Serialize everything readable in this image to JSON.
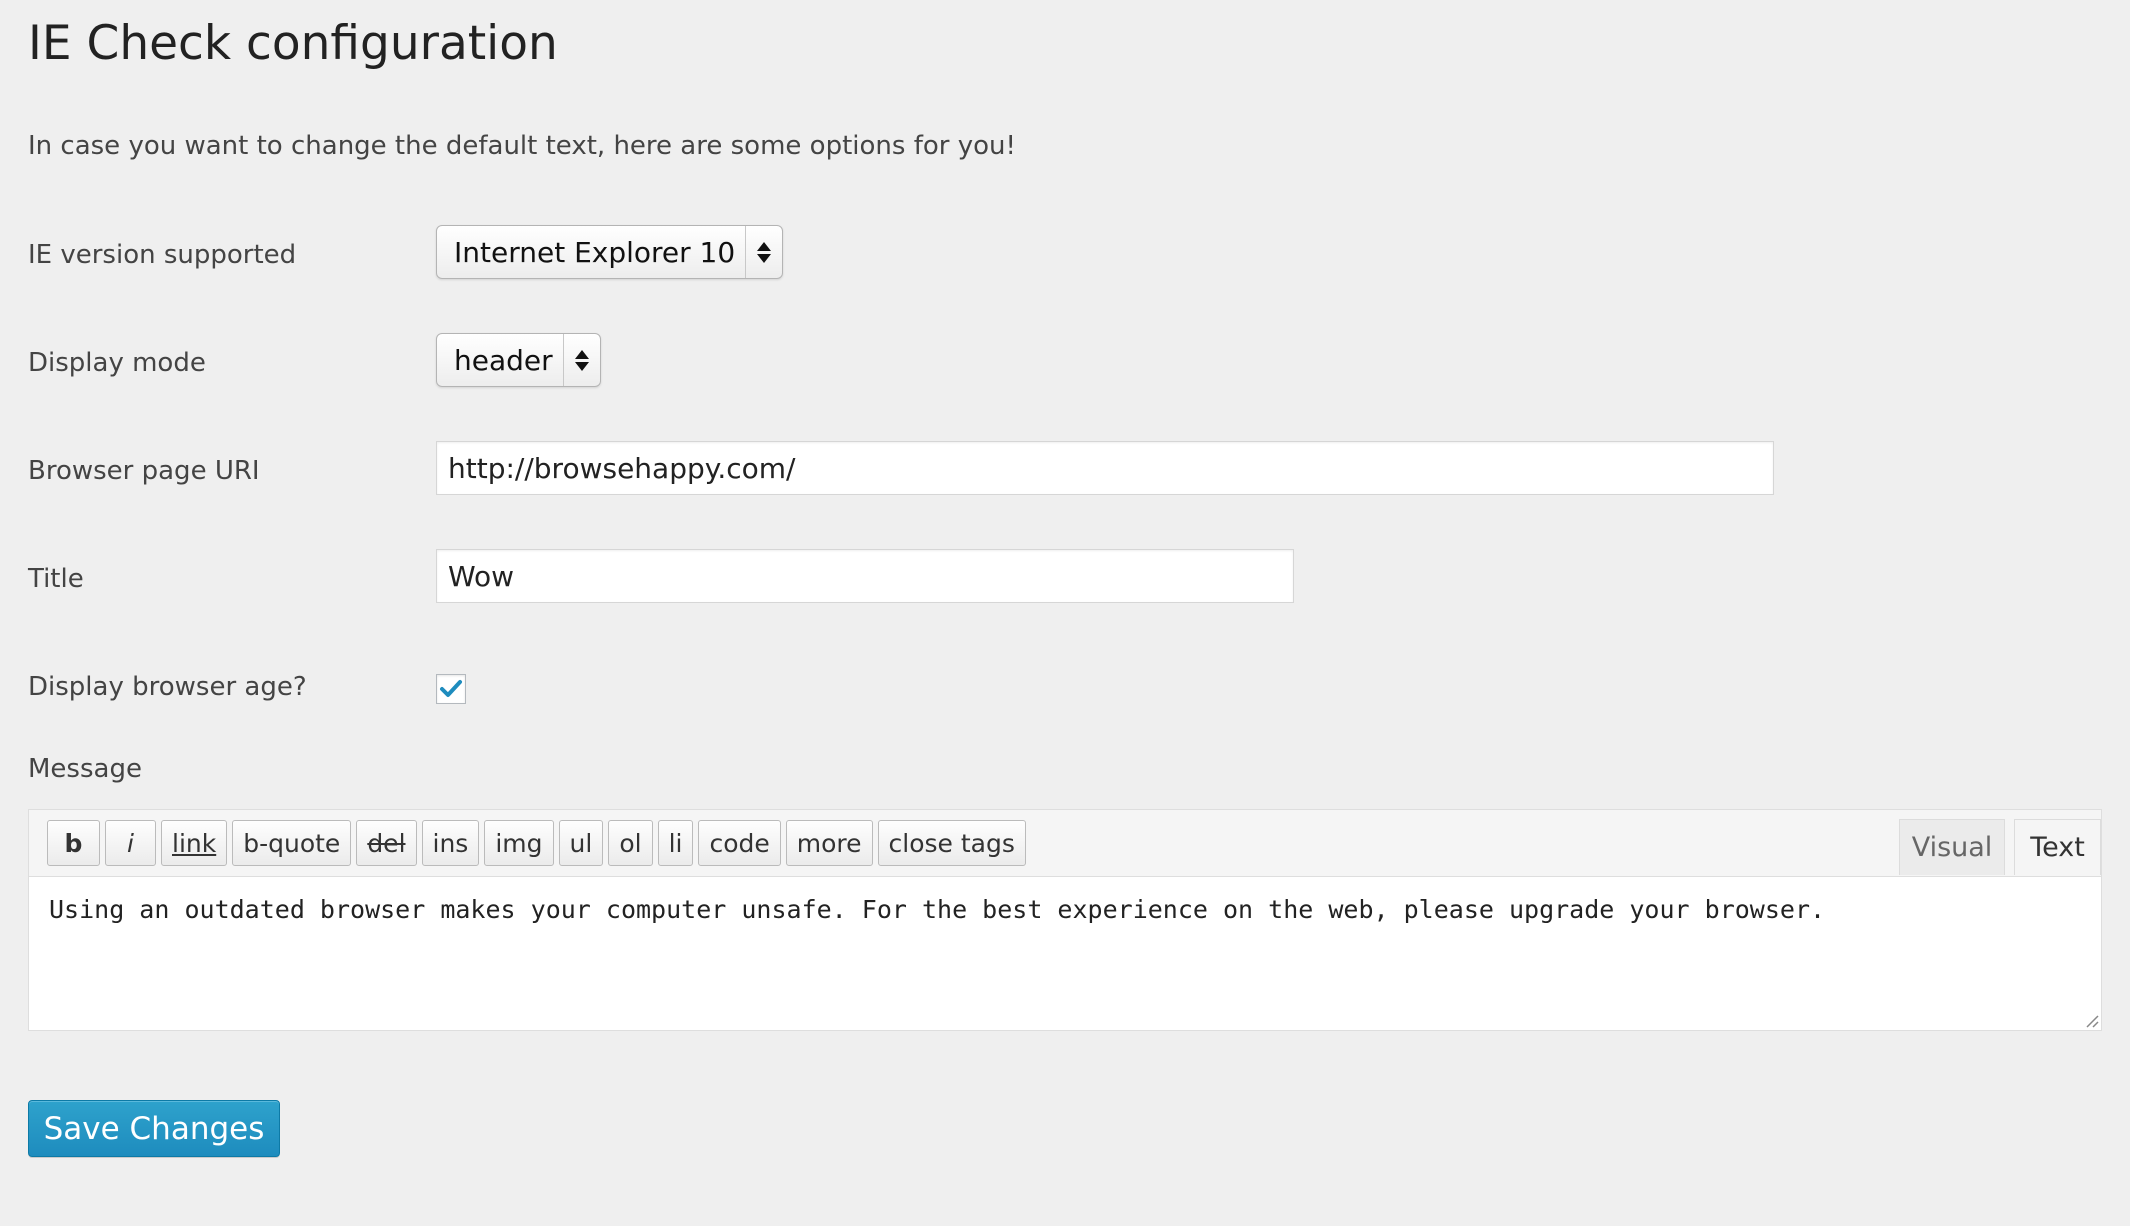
{
  "page": {
    "title": "IE Check configuration",
    "intro": "In case you want to change the default text, here are some options for you!"
  },
  "fields": {
    "ie_version": {
      "label": "IE version supported",
      "selected": "Internet Explorer 10"
    },
    "display_mode": {
      "label": "Display mode",
      "selected": "header"
    },
    "browser_uri": {
      "label": "Browser page URI",
      "value": "http://browsehappy.com/"
    },
    "title": {
      "label": "Title",
      "value": "Wow"
    },
    "display_age": {
      "label": "Display browser age?",
      "checked": true
    },
    "message": {
      "label": "Message",
      "value": "Using an outdated browser makes your computer unsafe. For the best experience on the web, please upgrade your browser."
    }
  },
  "editor": {
    "quicktags": [
      "b",
      "i",
      "link",
      "b-quote",
      "del",
      "ins",
      "img",
      "ul",
      "ol",
      "li",
      "code",
      "more",
      "close tags"
    ],
    "tab_visual": "Visual",
    "tab_text": "Text",
    "active_tab": "Text"
  },
  "actions": {
    "save_label": "Save Changes"
  },
  "colors": {
    "background": "#efefef",
    "primary_button": "#2ea2cc",
    "checkmark": "#1e8cbe"
  },
  "icons": {
    "select_arrows": "up-down-arrows-icon",
    "checkbox": "checkmark-icon",
    "resize": "resize-grip-icon"
  }
}
